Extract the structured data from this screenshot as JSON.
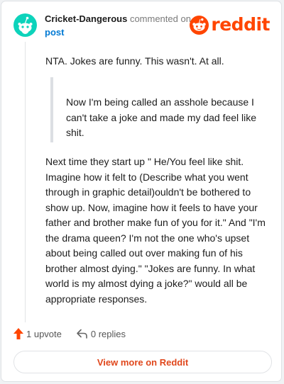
{
  "header": {
    "username": "Cricket-Dangerous",
    "action_text": "commented on",
    "link_text": "post"
  },
  "brand": {
    "wordmark": "reddit",
    "icon": "reddit-alien-icon",
    "color": "#ff4500"
  },
  "comment": {
    "intro": "NTA. Jokes are funny. This wasn't. At all.",
    "quote": "Now I'm being called an asshole because I can't take a joke and made my dad feel like shit.",
    "body": "Next time they start up \" He/You feel like shit. Imagine how it felt to (Describe what you went through in graphic detail)ouldn't be bothered to show up. Now, imagine how it feels to have your father and brother make fun of you for it.\" And \"I'm the drama queen? I'm not the one who's upset about being called out over making fun of his brother almost dying.\" \"Jokes are funny. In what world is my almost dying a joke?\" would all be appropriate responses."
  },
  "actions": {
    "upvote_label": "1 upvote",
    "upvote_icon": "upvote-arrow-icon",
    "upvote_color": "#ff4500",
    "reply_label": "0 replies",
    "reply_icon": "reply-arrow-icon"
  },
  "footer": {
    "button_label": "View more on Reddit",
    "button_color": "#e0471c"
  }
}
